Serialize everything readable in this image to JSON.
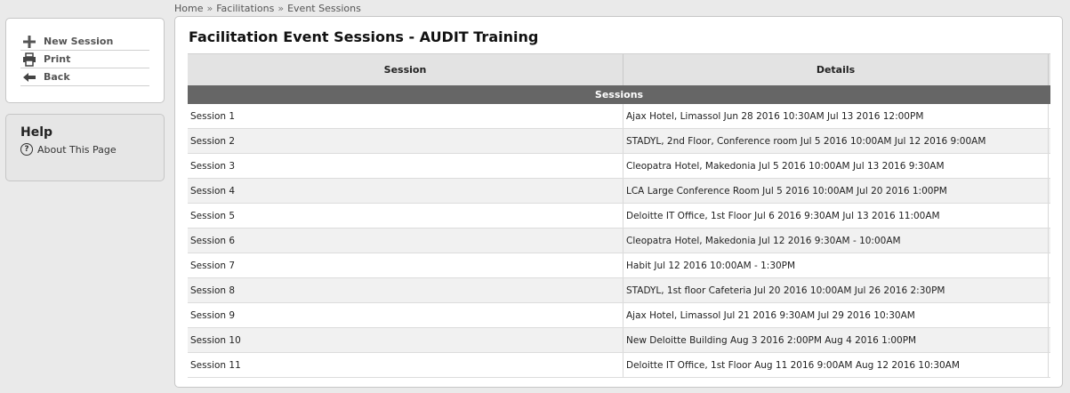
{
  "breadcrumb": {
    "items": [
      "Home",
      "Facilitations",
      "Event Sessions"
    ],
    "separator": "»"
  },
  "actions": [
    {
      "label": "New Session",
      "icon": "plus-icon"
    },
    {
      "label": "Print",
      "icon": "printer-icon"
    },
    {
      "label": "Back",
      "icon": "back-arrow-icon"
    }
  ],
  "help": {
    "title": "Help",
    "about_label": "About This Page"
  },
  "main": {
    "title": "Facilitation Event Sessions - AUDIT Training",
    "columns": [
      "Session",
      "Details"
    ],
    "group_label": "Sessions",
    "rows": [
      {
        "session": "Session 1",
        "details": "Ajax Hotel, Limassol Jun 28 2016 10:30AM Jul 13 2016 12:00PM"
      },
      {
        "session": "Session 2",
        "details": "STADYL, 2nd Floor, Conference room Jul 5 2016 10:00AM Jul 12 2016 9:00AM"
      },
      {
        "session": "Session 3",
        "details": "Cleopatra Hotel, Makedonia Jul 5 2016 10:00AM Jul 13 2016 9:30AM"
      },
      {
        "session": "Session 4",
        "details": "LCA Large Conference Room Jul 5 2016 10:00AM Jul 20 2016 1:00PM"
      },
      {
        "session": "Session 5",
        "details": "Deloitte IT Office, 1st Floor Jul 6 2016 9:30AM Jul 13 2016 11:00AM"
      },
      {
        "session": "Session 6",
        "details": "Cleopatra Hotel, Makedonia Jul 12 2016 9:30AM - 10:00AM"
      },
      {
        "session": "Session 7",
        "details": "Habit Jul 12 2016 10:00AM - 1:30PM"
      },
      {
        "session": "Session 8",
        "details": "STADYL, 1st floor Cafeteria Jul 20 2016 10:00AM Jul 26 2016 2:30PM"
      },
      {
        "session": "Session 9",
        "details": "Ajax Hotel, Limassol Jul 21 2016 9:30AM Jul 29 2016 10:30AM"
      },
      {
        "session": "Session 10",
        "details": "New Deloitte Building Aug 3 2016 2:00PM Aug 4 2016 1:00PM"
      },
      {
        "session": "Session 11",
        "details": "Deloitte IT Office, 1st Floor Aug 11 2016 9:00AM Aug 12 2016 10:30AM"
      }
    ]
  },
  "colors": {
    "group_header_bg": "#666666",
    "table_header_bg": "#e3e3e3",
    "page_bg": "#eaeaea"
  }
}
